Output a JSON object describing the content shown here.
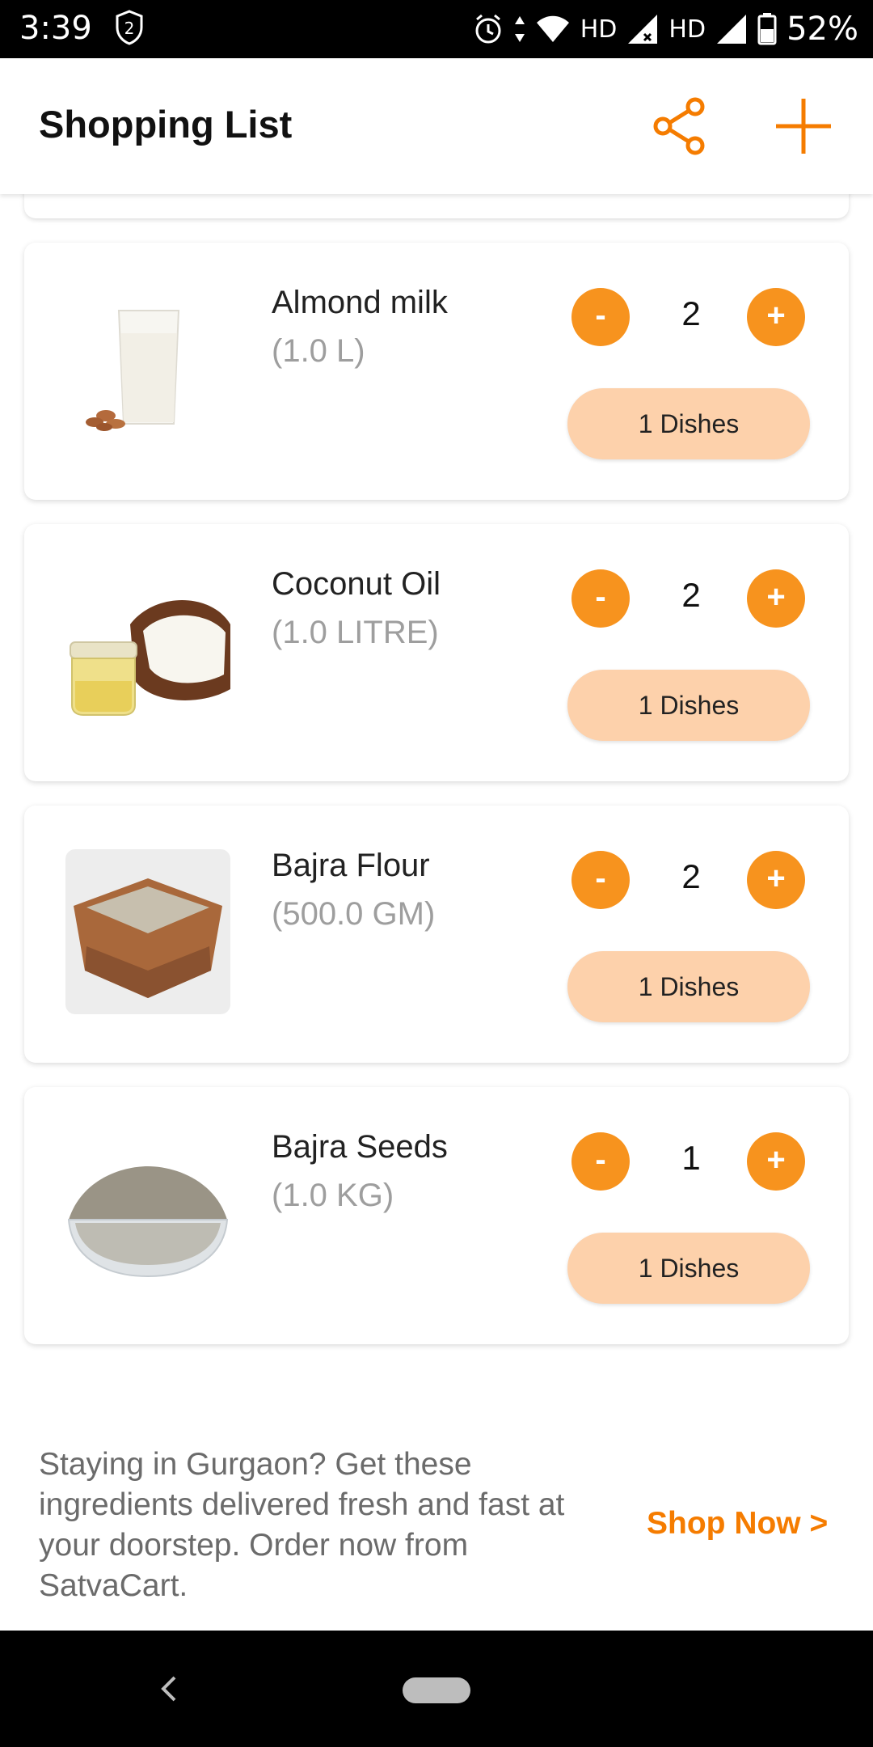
{
  "status_bar": {
    "time": "3:39",
    "notification_badge": "2",
    "hd1": "HD",
    "hd2": "HD",
    "battery": "52%"
  },
  "header": {
    "title": "Shopping List",
    "share_icon": "share-icon",
    "add_icon": "plus-icon"
  },
  "items": [
    {
      "name": "Almond milk",
      "quantity_unit": "(1.0 L)",
      "count": "2",
      "dishes_label": "1 Dishes",
      "image": "almond-milk-glass"
    },
    {
      "name": "Coconut Oil",
      "quantity_unit": "(1.0 LITRE)",
      "count": "2",
      "dishes_label": "1 Dishes",
      "image": "coconut-oil-jar"
    },
    {
      "name": "Bajra Flour",
      "quantity_unit": "(500.0 GM)",
      "count": "2",
      "dishes_label": "1 Dishes",
      "image": "flour-bowl"
    },
    {
      "name": "Bajra Seeds",
      "quantity_unit": "(1.0 KG)",
      "count": "1",
      "dishes_label": "1 Dishes",
      "image": "seeds-bowl"
    }
  ],
  "controls": {
    "minus": "-",
    "plus": "+"
  },
  "promo": {
    "text": "Staying in Gurgaon? Get these ingredients delivered fresh and fast at your doorstep. Order now from SatvaCart.",
    "cta": "Shop Now >"
  },
  "colors": {
    "accent": "#f7931e",
    "dishes_bg": "#fdd1ab",
    "cta": "#f57c00"
  }
}
